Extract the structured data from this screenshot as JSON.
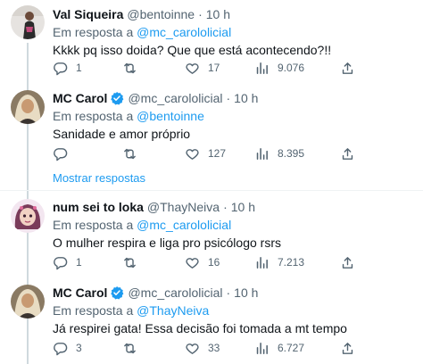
{
  "colors": {
    "accent": "#1d9bf0",
    "text": "#0f1419",
    "secondary": "#536471",
    "border": "#eff3f4",
    "thread": "#cfd9de"
  },
  "reply_prefix": "Em resposta a",
  "show_replies_label": "Mostrar respostas",
  "tweets": [
    {
      "name": "Val Siqueira",
      "handle": "@bentoinne",
      "dot": "·",
      "time": "10 h",
      "verified": false,
      "reply_to": null,
      "text": "Kkkk pq isso doida? Que que está acontecendo?!!",
      "stats": {
        "replies": "1",
        "retweets": "",
        "likes": "17",
        "views": "9.076"
      }
    },
    {
      "name": "MC Carol",
      "handle": "@mc_carololicial",
      "dot": "·",
      "time": "10 h",
      "verified": true,
      "reply_to": "@bentoinne",
      "text": "Sanidade e amor próprio",
      "stats": {
        "replies": "",
        "retweets": "",
        "likes": "127",
        "views": "8.395"
      }
    },
    {
      "name": "num sei to loka",
      "handle": "@ThayNeiva",
      "dot": "·",
      "time": "10 h",
      "verified": false,
      "reply_to": "@mc_carololicial",
      "text": "O mulher respira e liga pro psicólogo rsrs",
      "stats": {
        "replies": "1",
        "retweets": "",
        "likes": "16",
        "views": "7.213"
      }
    },
    {
      "name": "MC Carol",
      "handle": "@mc_carololicial",
      "dot": "·",
      "time": "10 h",
      "verified": true,
      "reply_to": "@ThayNeiva",
      "text": "Já respirei gata! Essa decisão foi tomada a mt tempo",
      "stats": {
        "replies": "3",
        "retweets": "",
        "likes": "33",
        "views": "6.727"
      }
    }
  ]
}
